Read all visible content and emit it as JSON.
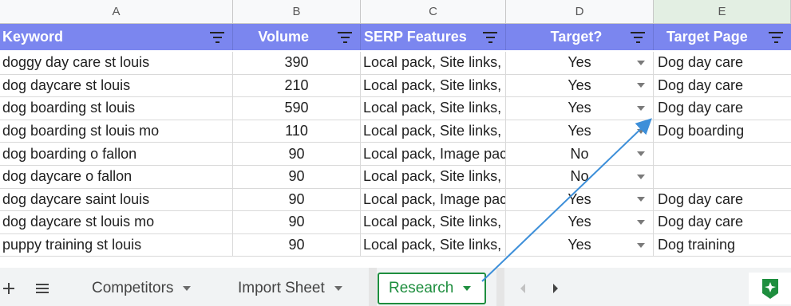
{
  "columns": [
    "A",
    "B",
    "C",
    "D",
    "E"
  ],
  "headers": [
    "Keyword",
    "Volume",
    "SERP Features",
    "Target?",
    "Target Page"
  ],
  "rows": [
    [
      "doggy day care st louis",
      "390",
      "Local pack, Site links,",
      "Yes",
      "Dog day care"
    ],
    [
      "dog daycare st louis",
      "210",
      "Local pack, Site links,",
      "Yes",
      "Dog day care"
    ],
    [
      "dog boarding st louis",
      "590",
      "Local pack, Site links,",
      "Yes",
      "Dog day care"
    ],
    [
      "dog boarding st louis mo",
      "110",
      "Local pack, Site links,",
      "Yes",
      "Dog boarding"
    ],
    [
      "dog boarding o fallon",
      "90",
      "Local pack, Image pac",
      "No",
      ""
    ],
    [
      "dog daycare o fallon",
      "90",
      "Local pack, Site links,",
      "No",
      ""
    ],
    [
      "dog daycare saint louis",
      "90",
      "Local pack, Image pac",
      "Yes",
      "Dog day care"
    ],
    [
      "dog daycare st louis mo",
      "90",
      "Local pack, Site links,",
      "Yes",
      "Dog day care"
    ],
    [
      "puppy training st louis",
      "90",
      "Local pack, Site links,",
      "Yes",
      "Dog training"
    ]
  ],
  "tabs": {
    "add_icon": "plus-icon",
    "list_icon": "menu-icon",
    "competitors": "Competitors",
    "import_sheet": "Import Sheet",
    "research": "Research"
  },
  "colors": {
    "header": "#7b86ef",
    "accent": "#1e8e3e",
    "arrow": "#3d8fd9"
  }
}
